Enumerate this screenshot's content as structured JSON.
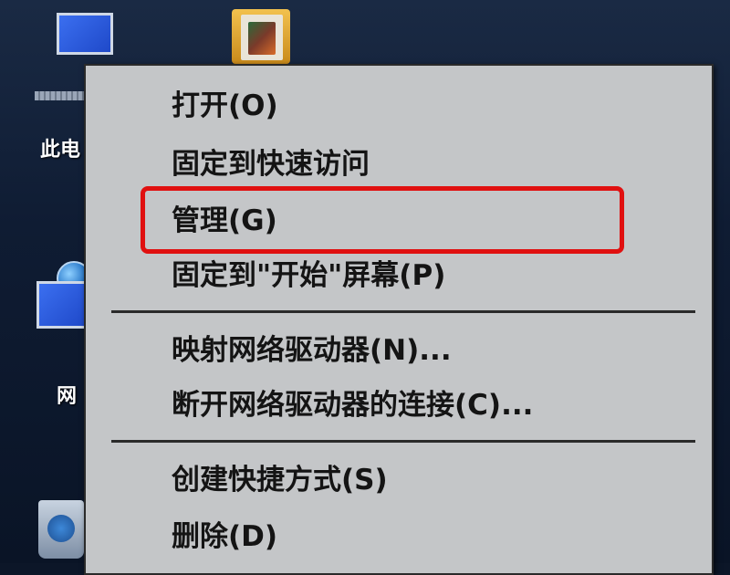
{
  "desktop": {
    "icons": [
      {
        "label": "此电",
        "icon": "computer-icon"
      },
      {
        "label": "网",
        "icon": "network-icon"
      },
      {
        "label": "",
        "icon": "recycle-bin-icon"
      },
      {
        "label": "",
        "icon": "folder-icon"
      }
    ]
  },
  "context_menu": {
    "items": [
      {
        "label": "打开(O)"
      },
      {
        "label": "固定到快速访问"
      },
      {
        "label": "管理(G)",
        "highlighted": true
      },
      {
        "label": "固定到\"开始\"屏幕(P)"
      },
      {
        "label": "映射网络驱动器(N)..."
      },
      {
        "label": "断开网络驱动器的连接(C)..."
      },
      {
        "label": "创建快捷方式(S)"
      },
      {
        "label": "删除(D)"
      }
    ]
  },
  "colors": {
    "highlight_border": "#e01010",
    "menu_background": "#c4c6c8",
    "desktop_background": "#0c1628"
  }
}
